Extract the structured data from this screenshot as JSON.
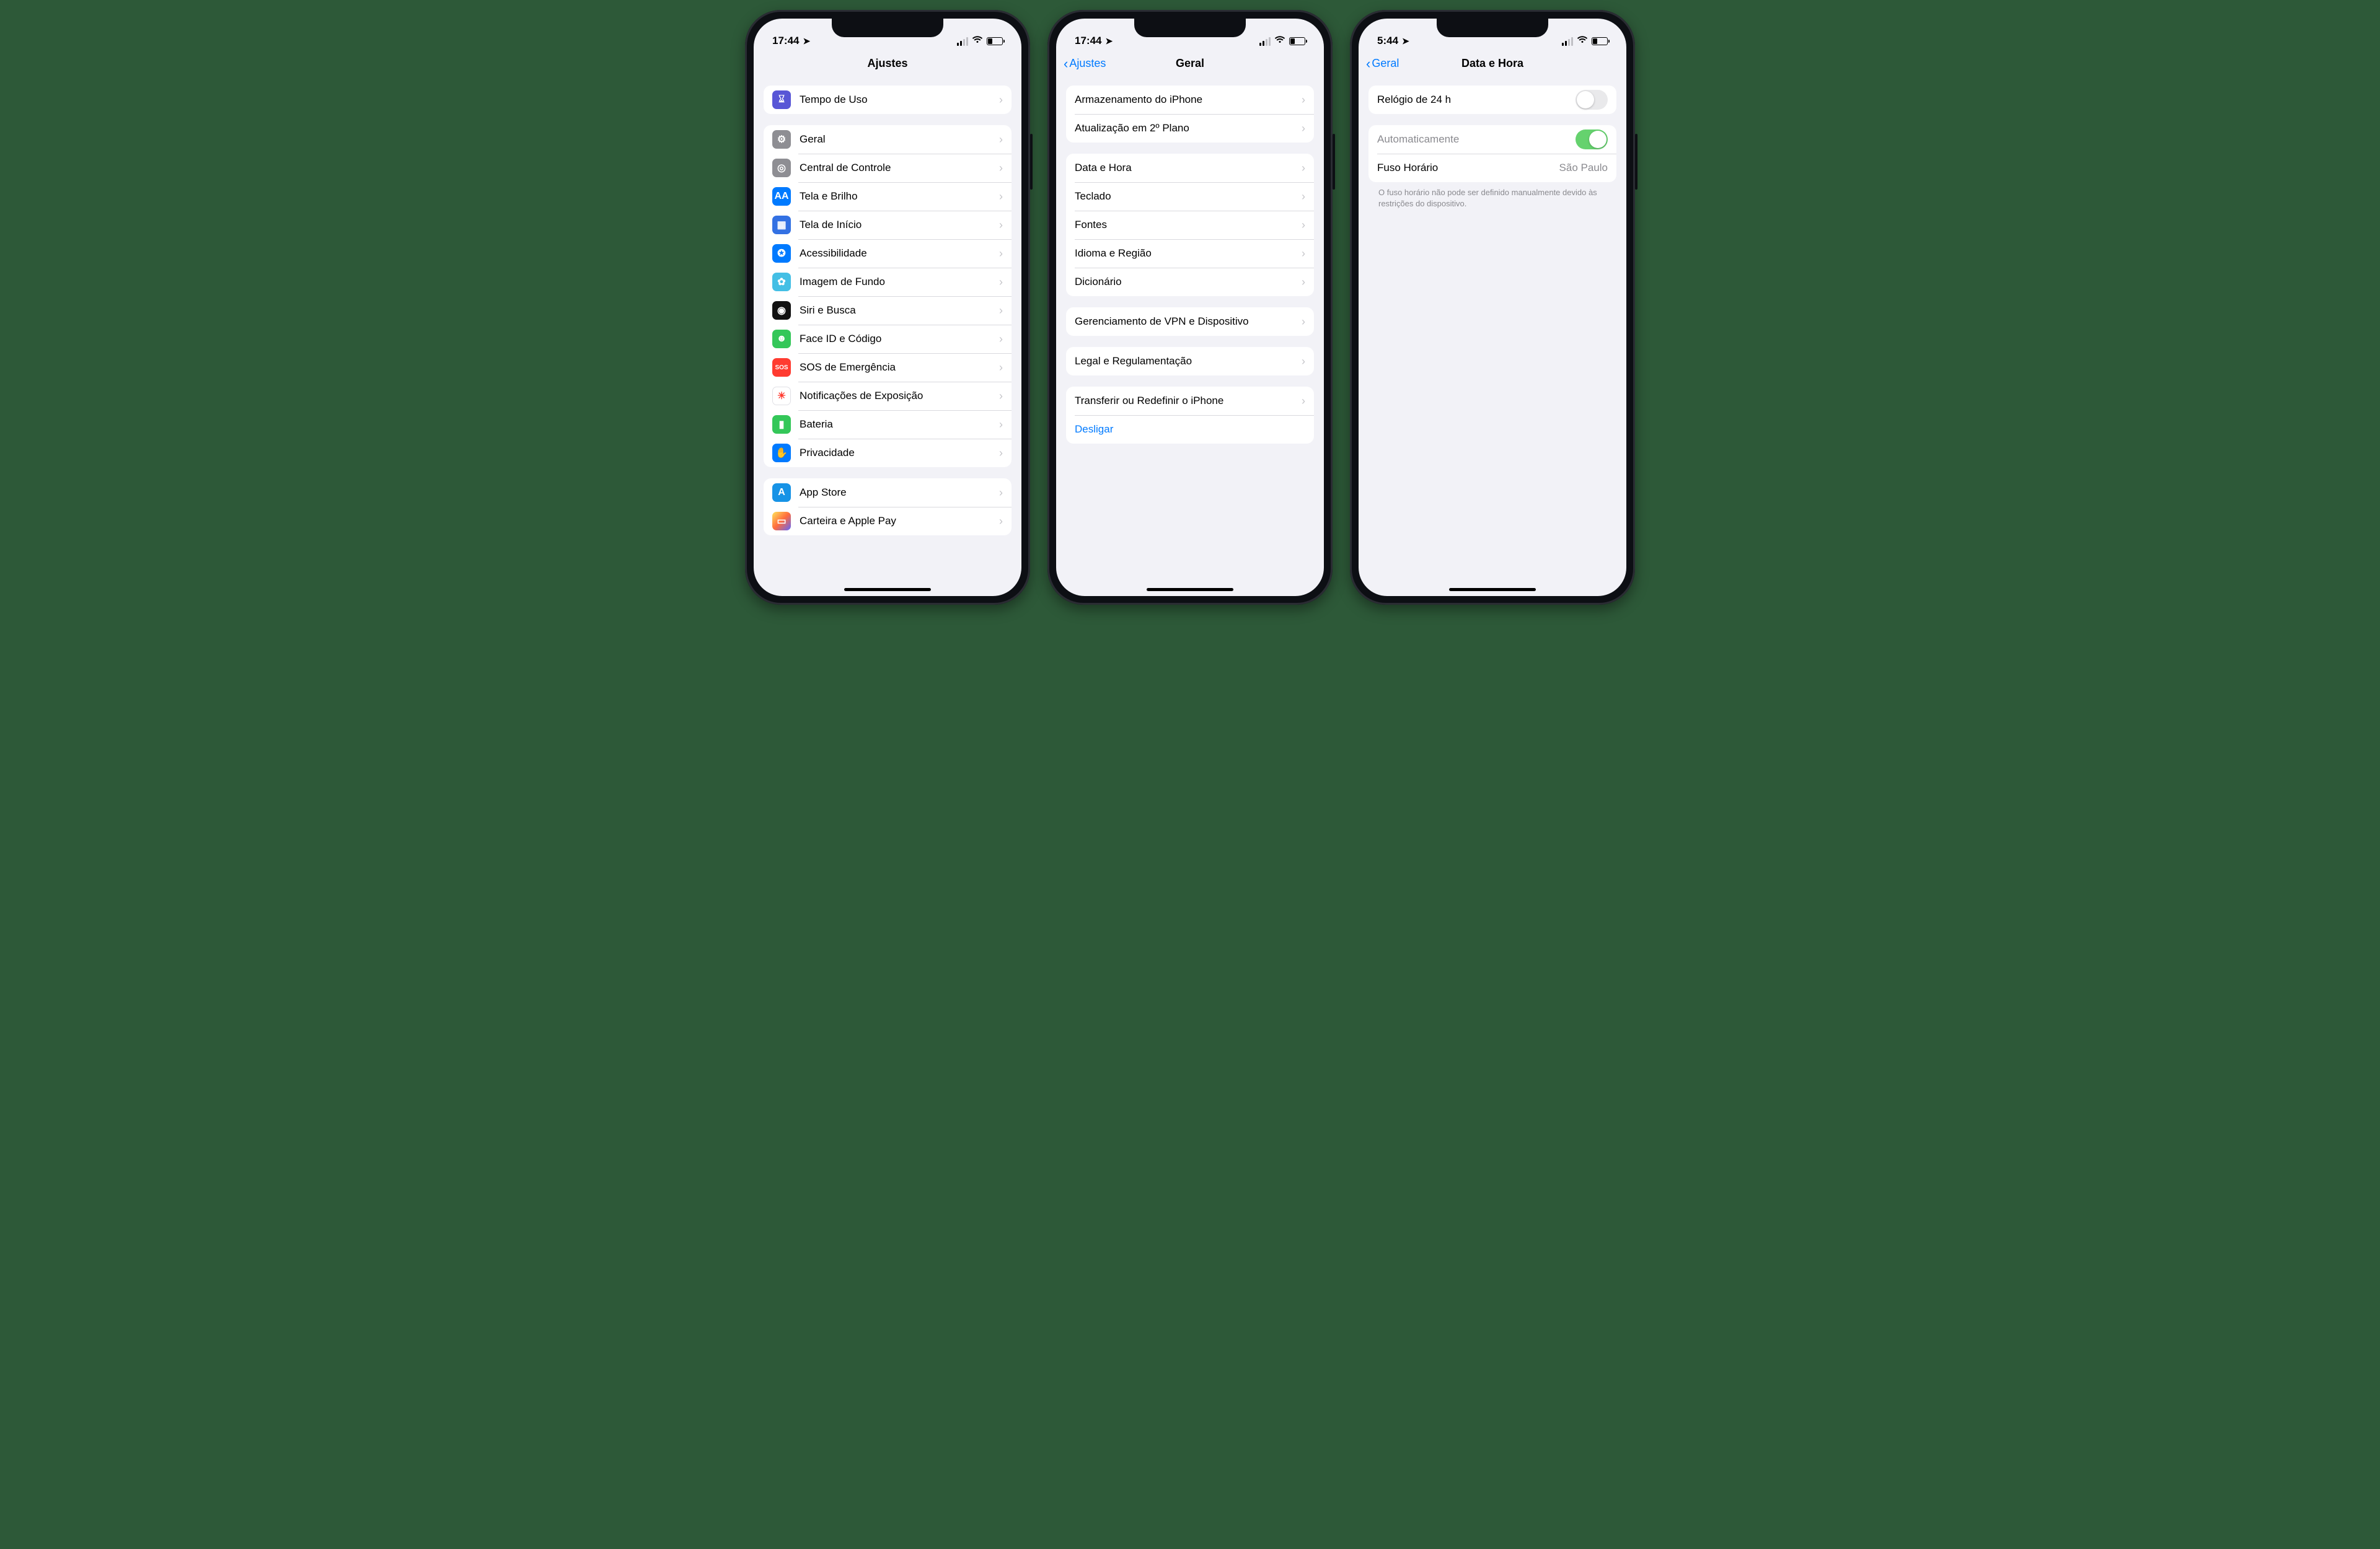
{
  "phones": [
    {
      "status_time": "17:44",
      "nav": {
        "title": "Ajustes",
        "back": null
      },
      "sections": [
        {
          "rows": [
            {
              "icon": {
                "bg": "bg-purple",
                "glyph": "⌛︎",
                "name": "hourglass-icon"
              },
              "label": "Tempo de Uso",
              "disclosure": true,
              "name": "row-tempo-de-uso"
            }
          ]
        },
        {
          "rows": [
            {
              "icon": {
                "bg": "bg-gray",
                "glyph": "⚙︎",
                "name": "gear-icon"
              },
              "label": "Geral",
              "disclosure": true,
              "name": "row-geral"
            },
            {
              "icon": {
                "bg": "bg-gray",
                "glyph": "◎",
                "name": "toggles-icon"
              },
              "label": "Central de Controle",
              "disclosure": true,
              "name": "row-central-controle"
            },
            {
              "icon": {
                "bg": "bg-blue",
                "glyph": "AA",
                "name": "display-icon"
              },
              "label": "Tela e Brilho",
              "disclosure": true,
              "name": "row-tela-brilho"
            },
            {
              "icon": {
                "bg": "bg-darkblue",
                "glyph": "▦",
                "name": "home-screen-icon"
              },
              "label": "Tela de Início",
              "disclosure": true,
              "name": "row-tela-inicio"
            },
            {
              "icon": {
                "bg": "bg-blue",
                "glyph": "✪",
                "name": "accessibility-icon"
              },
              "label": "Acessibilidade",
              "disclosure": true,
              "name": "row-acessibilidade"
            },
            {
              "icon": {
                "bg": "bg-cyan",
                "glyph": "✿",
                "name": "wallpaper-icon"
              },
              "label": "Imagem de Fundo",
              "disclosure": true,
              "name": "row-imagem-fundo"
            },
            {
              "icon": {
                "bg": "bg-black",
                "glyph": "◉",
                "name": "siri-icon"
              },
              "label": "Siri e Busca",
              "disclosure": true,
              "name": "row-siri-busca"
            },
            {
              "icon": {
                "bg": "bg-green",
                "glyph": "☻",
                "name": "faceid-icon"
              },
              "label": "Face ID e Código",
              "disclosure": true,
              "name": "row-faceid"
            },
            {
              "icon": {
                "bg": "bg-red",
                "glyph": "SOS",
                "name": "sos-icon"
              },
              "label": "SOS de Emergência",
              "disclosure": true,
              "name": "row-sos"
            },
            {
              "icon": {
                "bg": "bg-white",
                "glyph": "☀︎",
                "name": "exposure-icon"
              },
              "label": "Notificações de Exposição",
              "disclosure": true,
              "name": "row-exposicao"
            },
            {
              "icon": {
                "bg": "bg-green",
                "glyph": "▮",
                "name": "battery-icon"
              },
              "label": "Bateria",
              "disclosure": true,
              "name": "row-bateria"
            },
            {
              "icon": {
                "bg": "bg-blue",
                "glyph": "✋",
                "name": "privacy-icon"
              },
              "label": "Privacidade",
              "disclosure": true,
              "name": "row-privacidade"
            }
          ]
        },
        {
          "rows": [
            {
              "icon": {
                "bg": "bg-blue2",
                "glyph": "A",
                "name": "appstore-icon"
              },
              "label": "App Store",
              "disclosure": true,
              "name": "row-appstore"
            },
            {
              "icon": {
                "bg": "bg-grad",
                "glyph": "▭",
                "name": "wallet-icon"
              },
              "label": "Carteira e Apple Pay",
              "disclosure": true,
              "name": "row-carteira",
              "clipped": true
            }
          ]
        }
      ]
    },
    {
      "status_time": "17:44",
      "nav": {
        "title": "Geral",
        "back": "Ajustes"
      },
      "sections": [
        {
          "rows": [
            {
              "label": "Armazenamento do iPhone",
              "disclosure": true,
              "name": "row-armazenamento"
            },
            {
              "label": "Atualização em 2º Plano",
              "disclosure": true,
              "name": "row-atualizacao-plano"
            }
          ]
        },
        {
          "rows": [
            {
              "label": "Data e Hora",
              "disclosure": true,
              "name": "row-data-hora"
            },
            {
              "label": "Teclado",
              "disclosure": true,
              "name": "row-teclado"
            },
            {
              "label": "Fontes",
              "disclosure": true,
              "name": "row-fontes"
            },
            {
              "label": "Idioma e Região",
              "disclosure": true,
              "name": "row-idioma-regiao"
            },
            {
              "label": "Dicionário",
              "disclosure": true,
              "name": "row-dicionario"
            }
          ]
        },
        {
          "rows": [
            {
              "label": "Gerenciamento de VPN e Dispositivo",
              "disclosure": true,
              "name": "row-vpn-dispositivo"
            }
          ]
        },
        {
          "rows": [
            {
              "label": "Legal e Regulamentação",
              "disclosure": true,
              "name": "row-legal"
            }
          ]
        },
        {
          "rows": [
            {
              "label": "Transferir ou Redefinir o iPhone",
              "disclosure": true,
              "name": "row-transferir-redefinir"
            },
            {
              "label": "Desligar",
              "link": true,
              "name": "row-desligar"
            }
          ]
        }
      ]
    },
    {
      "status_time": "5:44",
      "nav": {
        "title": "Data e Hora",
        "back": "Geral"
      },
      "sections": [
        {
          "rows": [
            {
              "label": "Relógio de 24 h",
              "toggle": "off",
              "name": "row-relogio-24h"
            }
          ]
        },
        {
          "rows": [
            {
              "label": "Automaticamente",
              "toggle": "on",
              "disabled": true,
              "name": "row-automaticamente"
            },
            {
              "label": "Fuso Horário",
              "value": "São Paulo",
              "name": "row-fuso-horario"
            }
          ],
          "footer": "O fuso horário não pode ser definido manualmente devido às restrições do dispositivo."
        }
      ]
    }
  ]
}
